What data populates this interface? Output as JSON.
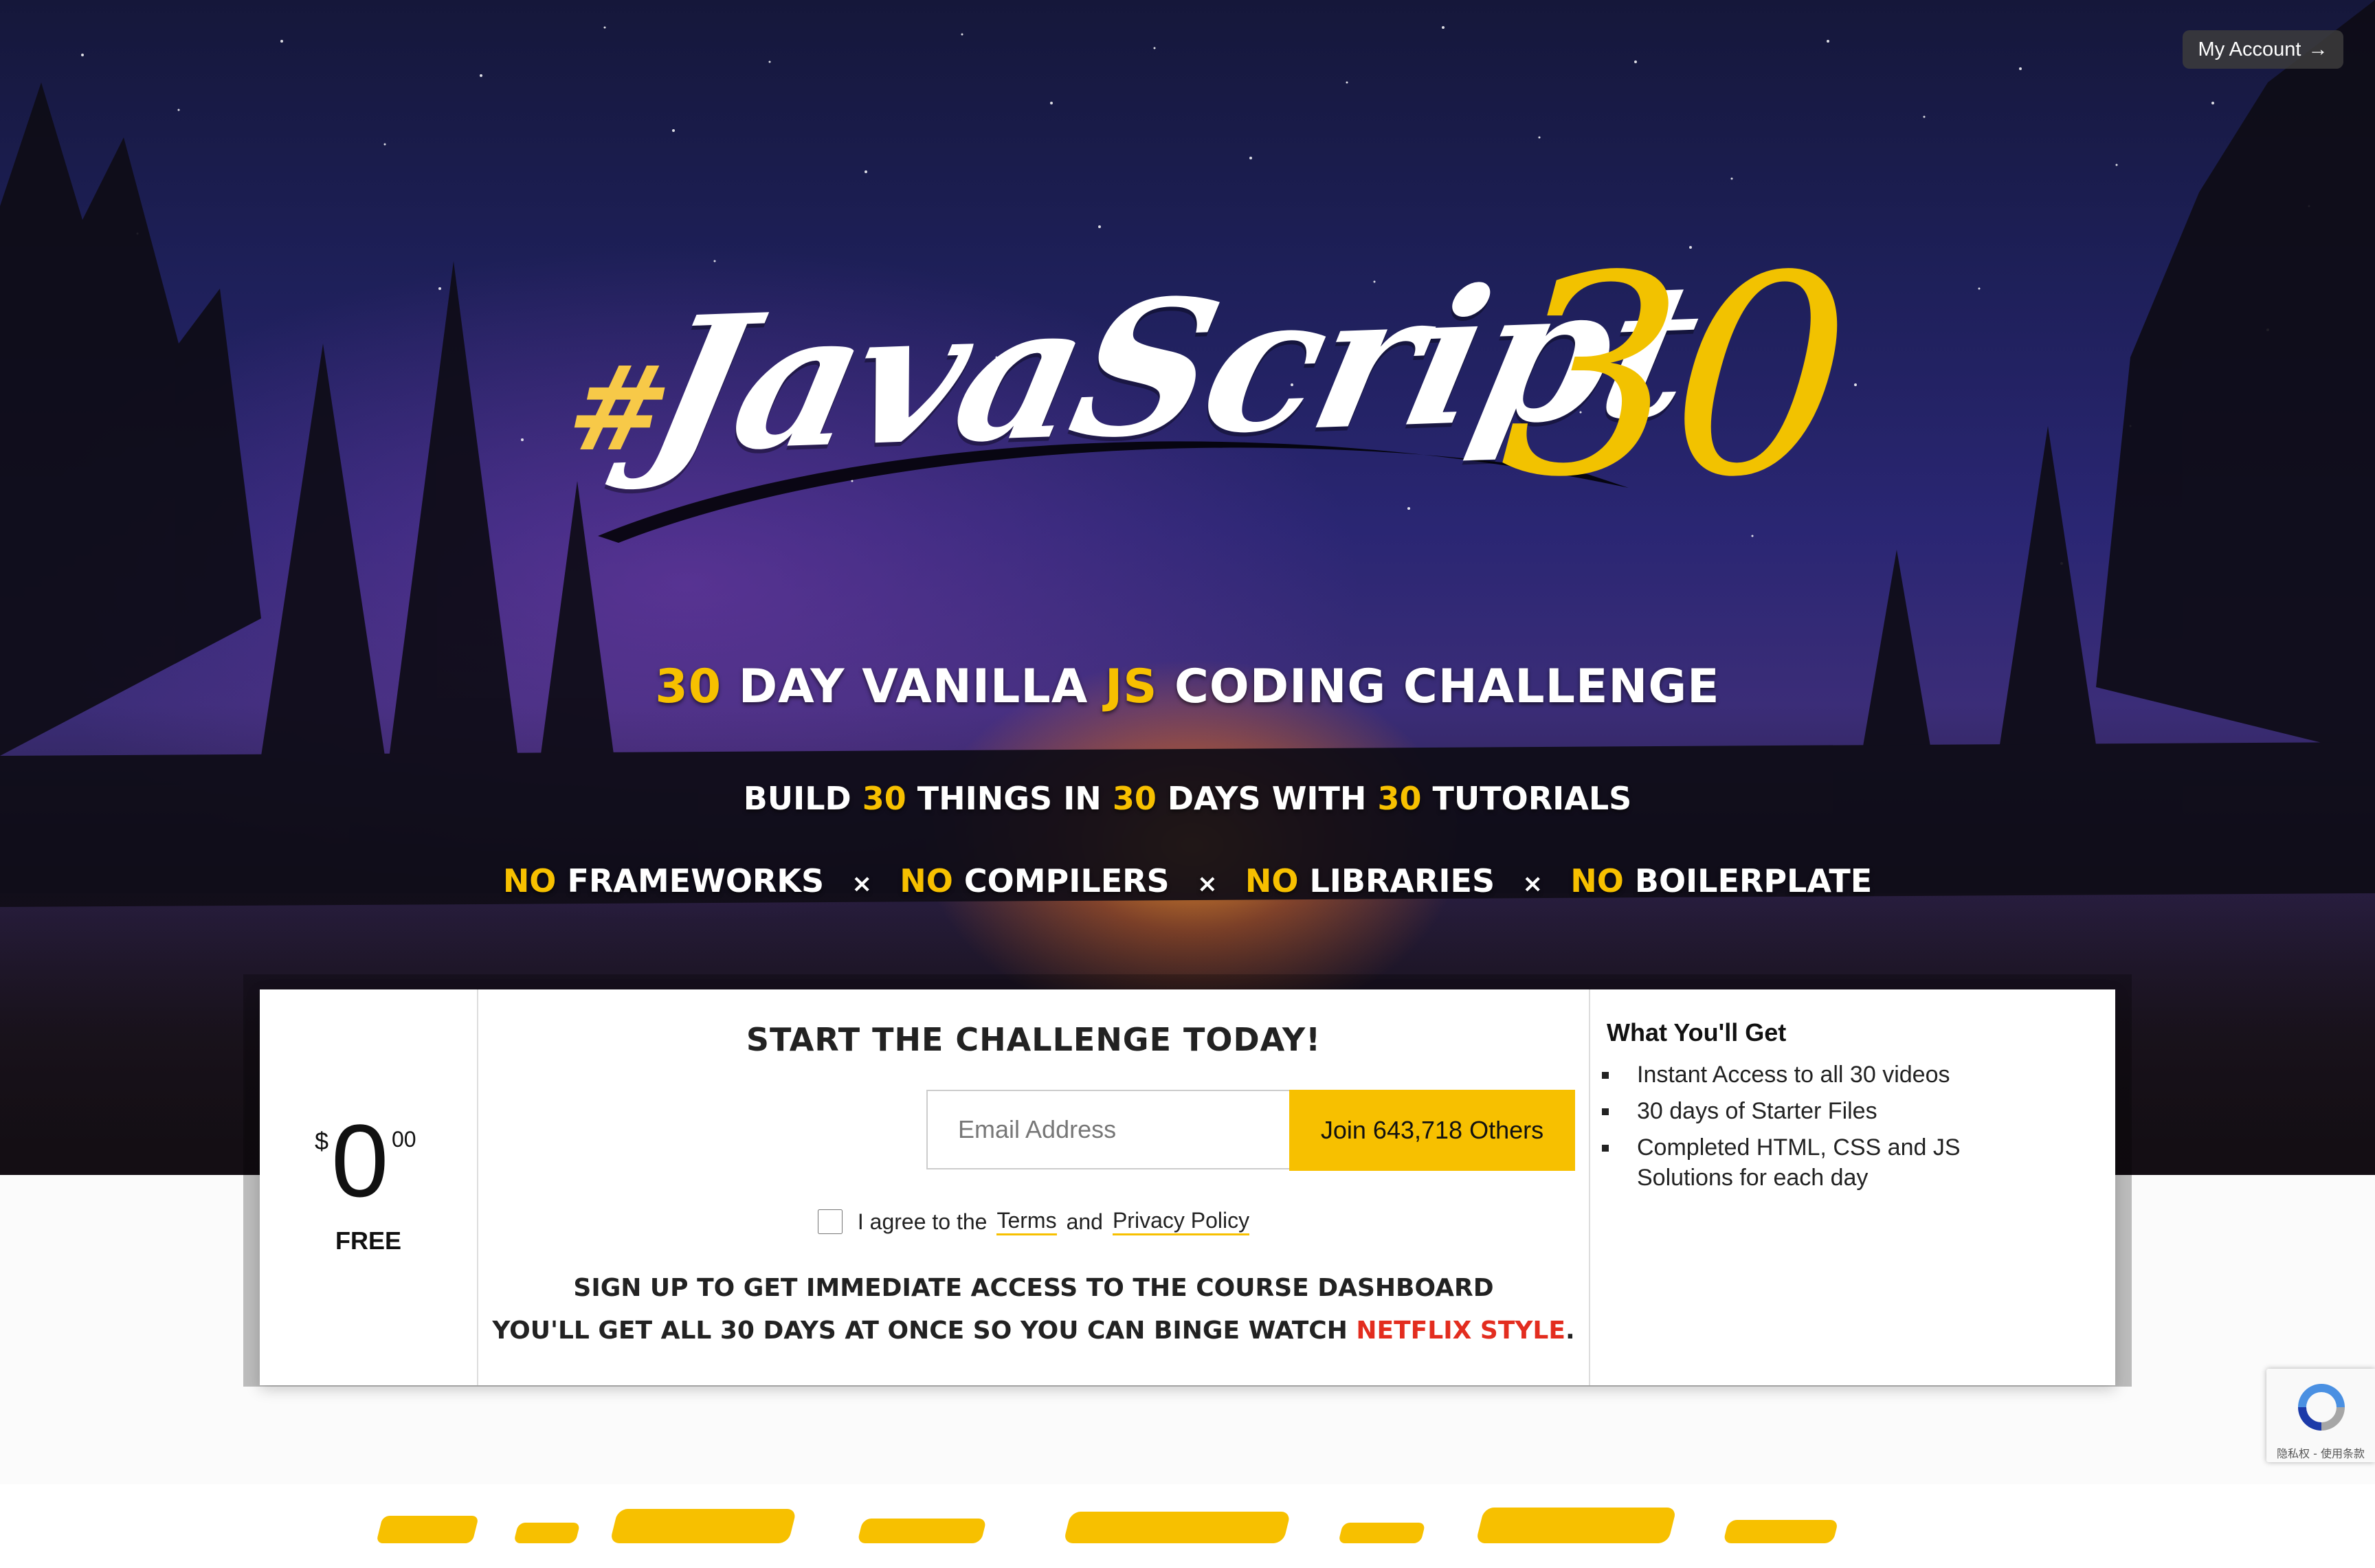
{
  "header": {
    "account_label": "My Account",
    "account_arrow": "→"
  },
  "logo": {
    "hash": "#",
    "word": "JavaScript",
    "number": "30"
  },
  "hero": {
    "tagline": {
      "num": "30",
      "part1": "Day Vanilla",
      "js": "JS",
      "part2": "Coding Challenge"
    },
    "subline": {
      "w1": "Build",
      "n1": "30",
      "w2": "Things in",
      "n2": "30",
      "w3": "Days with",
      "n3": "30",
      "w4": "Tutorials"
    },
    "no_items": [
      {
        "no": "No",
        "word": "Frameworks"
      },
      {
        "no": "No",
        "word": "Compilers"
      },
      {
        "no": "No",
        "word": "Libraries"
      },
      {
        "no": "No",
        "word": "Boilerplate"
      }
    ],
    "separator": "×"
  },
  "signup": {
    "price_currency": "$",
    "price_whole": "0",
    "price_cents": "00",
    "price_label": "FREE",
    "title": "Start the Challenge Today!",
    "email_placeholder": "Email Address",
    "join_label": "Join 643,718 Others",
    "agree_prefix": "I agree to the",
    "terms_link": "Terms",
    "agree_and": "and",
    "privacy_link": "Privacy Policy",
    "info_line1": "Sign up to get immediate access to the course dashboard",
    "info_line2_prefix": "You'll get all 30 days at once so you can binge watch",
    "info_line2_highlight": "Netflix Style",
    "info_line2_suffix": "."
  },
  "what_you_get": {
    "title": "What You'll Get",
    "items": [
      "Instant Access to all 30 videos",
      "30 days of Starter Files",
      "Completed HTML, CSS and JS Solutions for each day"
    ]
  },
  "recaptcha": {
    "text": "隐私权 - 使用条款"
  },
  "colors": {
    "accent": "#f7c000",
    "highlight_red": "#e32d1f",
    "sky_top": "#15173a",
    "sky_mid": "#2a2673"
  }
}
